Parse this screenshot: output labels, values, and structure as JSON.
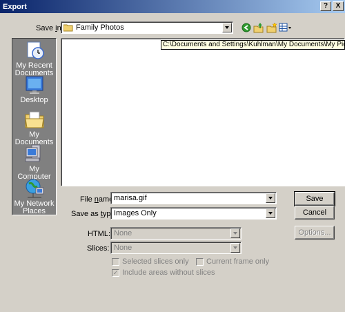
{
  "window": {
    "title": "Export",
    "help_label": "?",
    "close_label": "X"
  },
  "save_in": {
    "label": "Save in:",
    "label_pre": "Save ",
    "label_hot": "i",
    "label_post": "n:",
    "value": "Family Photos",
    "tooltip": "C:\\Documents and Settings\\Kuhlman\\My Documents\\My Pictures\\Family"
  },
  "toolbar": {
    "icons": [
      "back-icon",
      "up-folder-icon",
      "new-folder-icon",
      "view-menu-icon"
    ]
  },
  "places": [
    {
      "label": "My Recent Documents",
      "icon": "recent-documents-icon"
    },
    {
      "label": "Desktop",
      "icon": "desktop-icon"
    },
    {
      "label": "My Documents",
      "icon": "my-documents-icon"
    },
    {
      "label": "My Computer",
      "icon": "my-computer-icon"
    },
    {
      "label": "My Network Places",
      "icon": "network-places-icon"
    }
  ],
  "file_name": {
    "label_pre": "File ",
    "label_hot": "n",
    "label_post": "ame:",
    "value": "marisa.gif"
  },
  "save_as_type": {
    "label_pre": "Save as ",
    "label_hot": "t",
    "label_post": "ype:",
    "value": "Images Only"
  },
  "html": {
    "label": "HTML:",
    "value": "None"
  },
  "slices": {
    "label": "Slices:",
    "value": "None"
  },
  "buttons": {
    "save": "Save",
    "cancel": "Cancel",
    "options": "Options..."
  },
  "checkboxes": {
    "selected_slices": "Selected slices only",
    "current_frame": "Current frame only",
    "include_areas": "Include areas without slices"
  }
}
